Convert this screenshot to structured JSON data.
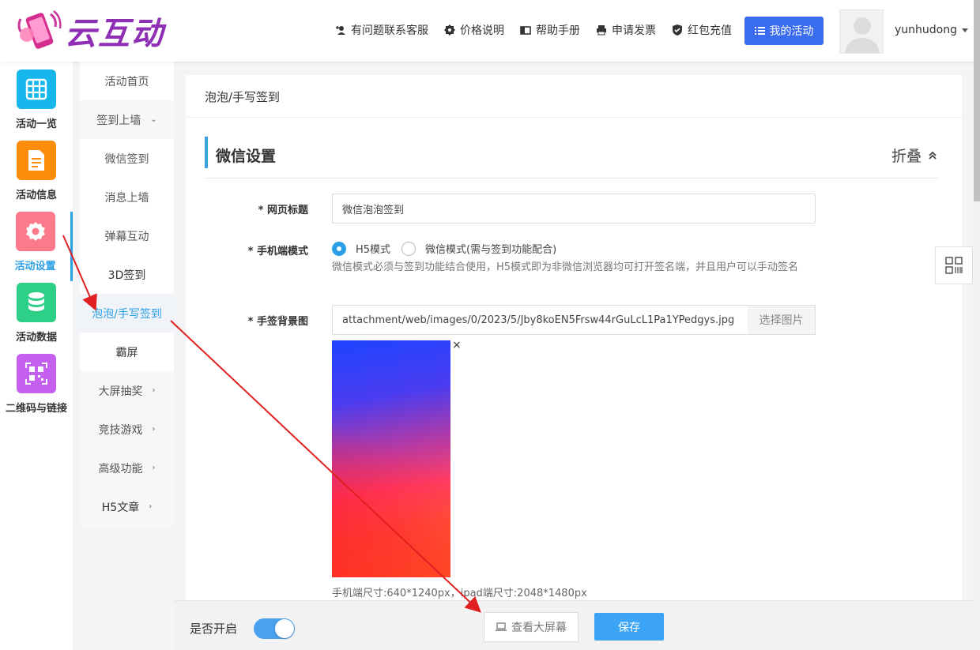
{
  "header": {
    "logo_text": "云互动",
    "nav": [
      {
        "icon": "add-user-icon",
        "label": "有问题联系客服"
      },
      {
        "icon": "gear-badge-icon",
        "label": "价格说明"
      },
      {
        "icon": "book-icon",
        "label": "帮助手册"
      },
      {
        "icon": "printer-icon",
        "label": "申请发票"
      },
      {
        "icon": "shield-check-icon",
        "label": "红包充值"
      }
    ],
    "my_activity_label": "我的活动",
    "username": "yunhudong"
  },
  "icon_sidebar": {
    "items": [
      {
        "label": "活动一览",
        "icon": "grid-icon",
        "color": "#16b7ec"
      },
      {
        "label": "活动信息",
        "icon": "document-icon",
        "color": "#fb8c0c"
      },
      {
        "label": "活动设置",
        "icon": "gear-icon",
        "color": "#fd7a8c",
        "active": true
      },
      {
        "label": "活动数据",
        "icon": "database-icon",
        "color": "#2ecf86"
      },
      {
        "label": "二维码与链接",
        "icon": "qrcode-icon",
        "color": "#c45ff0"
      }
    ]
  },
  "sub_sidebar": {
    "items": [
      {
        "label": "活动首页"
      },
      {
        "label": "签到上墙",
        "chevron": "⌄"
      },
      {
        "label": "微信签到"
      },
      {
        "label": "消息上墙"
      },
      {
        "label": "弹幕互动"
      },
      {
        "label": "3D签到"
      },
      {
        "label": "泡泡/手写签到",
        "active": true
      },
      {
        "label": "霸屏"
      },
      {
        "label": "大屏抽奖",
        "chevron": "›"
      },
      {
        "label": "竞技游戏",
        "chevron": "›"
      },
      {
        "label": "高级功能",
        "chevron": "›"
      },
      {
        "label": "H5文章",
        "chevron": "›"
      }
    ]
  },
  "main": {
    "breadcrumb": "泡泡/手写签到",
    "section_title": "微信设置",
    "fold_label": "折叠",
    "form": {
      "page_title_label": "* 网页标题",
      "page_title_value": "微信泡泡签到",
      "mobile_mode_label": "* 手机端模式",
      "mode_options": [
        "H5模式",
        "微信模式(需与签到功能配合)"
      ],
      "mode_selected": "H5模式",
      "mode_help": "微信模式必须与签到功能结合使用，H5模式即为非微信浏览器均可打开签名端，并且用户可以手动签名",
      "bg_label": "* 手签背景图",
      "bg_value": "attachment/web/images/0/2023/5/Jby8koEN5Frsw44rGuLcL1Pa1YPedgys.jpg",
      "pick_image_label": "选择图片",
      "close_symbol": "×",
      "size_note": "手机端尺寸:640*1240px，ipad端尺寸:2048*1480px"
    }
  },
  "footer": {
    "enable_label": "是否开启",
    "enabled": true,
    "preview_label": "查看大屏幕",
    "save_label": "保存"
  },
  "colors": {
    "accent": "#2d9fe6",
    "primary_button": "#3a6cf0",
    "save_button": "#3ba4f5",
    "annotation_arrow": "#e02020"
  }
}
